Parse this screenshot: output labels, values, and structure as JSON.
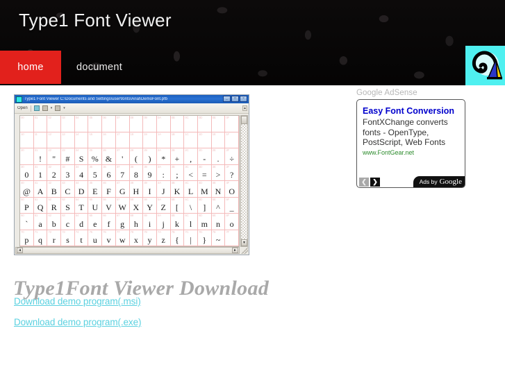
{
  "header": {
    "site_title": "Type1 Font Viewer",
    "logo_icon": "type1-font-logo-icon",
    "nav": [
      {
        "label": "home",
        "active": true
      },
      {
        "label": "document",
        "active": false
      }
    ]
  },
  "main": {
    "page_title": "Type1Font Viewer Download",
    "links": [
      {
        "label": "Download demo program(.msi)"
      },
      {
        "label": "Download demo program(.exe)"
      }
    ]
  },
  "screenshot": {
    "window_title": "Type1 Font Viewer C:\\Documents and Settings\\user\\fonts\\Arial\\DemoFont.pfb",
    "app_icon": "type1-font-app-icon",
    "toolbar": {
      "open_label": "Open",
      "icons": [
        "folder-open-icon",
        "zoom-icon",
        "print-icon"
      ]
    },
    "window_buttons": [
      "minimize",
      "maximize",
      "close"
    ],
    "charmap": {
      "hex_labels": [
        "00",
        "01",
        "02",
        "03",
        "04",
        "05",
        "06",
        "07",
        "08",
        "09",
        "0A",
        "0B",
        "0C",
        "0D",
        "0E",
        "0F",
        "10",
        "11",
        "12",
        "13",
        "14",
        "15",
        "16",
        "17",
        "18",
        "19",
        "1A",
        "1B",
        "1C",
        "1D",
        "1E",
        "1F",
        "20",
        "21",
        "22",
        "23",
        "24",
        "25",
        "26",
        "27",
        "28",
        "29",
        "2A",
        "2B",
        "2C",
        "2D",
        "2E",
        "2F",
        "30",
        "31",
        "32",
        "33",
        "34",
        "35",
        "36",
        "37",
        "38",
        "39",
        "3A",
        "3B",
        "3C",
        "3D",
        "3E",
        "3F",
        "40",
        "41",
        "42",
        "43",
        "44",
        "45",
        "46",
        "47",
        "48",
        "49",
        "4A",
        "4B",
        "4C",
        "4D",
        "4E",
        "4F",
        "50",
        "51",
        "52",
        "53",
        "54",
        "55",
        "56",
        "57",
        "58",
        "59",
        "5A",
        "5B",
        "5C",
        "5D",
        "5E",
        "5F",
        "60",
        "61",
        "62",
        "63",
        "64",
        "65",
        "66",
        "67",
        "68",
        "69",
        "6A",
        "6B",
        "6C",
        "6D",
        "6E",
        "6F",
        "70",
        "71",
        "72",
        "73",
        "74",
        "75",
        "76",
        "77",
        "78",
        "79",
        "7A",
        "7B",
        "7C",
        "7D",
        "7E",
        "7F"
      ],
      "glyphs": [
        "",
        "",
        "",
        "",
        "",
        "",
        "",
        "",
        "",
        "",
        "",
        "",
        "",
        "",
        "",
        "",
        "",
        "",
        "",
        "",
        "",
        "",
        "",
        "",
        "",
        "",
        "",
        "",
        "",
        "",
        "",
        "",
        "",
        "!",
        "\"",
        "#",
        "S",
        "%",
        "&",
        "'",
        "(",
        ")",
        "*",
        "+",
        ",",
        "-",
        ".",
        "÷",
        "0",
        "1",
        "2",
        "3",
        "4",
        "5",
        "6",
        "7",
        "8",
        "9",
        ":",
        ";",
        "<",
        "=",
        ">",
        "?",
        "@",
        "A",
        "B",
        "C",
        "D",
        "E",
        "F",
        "G",
        "H",
        "I",
        "J",
        "K",
        "L",
        "M",
        "N",
        "O",
        "P",
        "Q",
        "R",
        "S",
        "T",
        "U",
        "V",
        "W",
        "X",
        "Y",
        "Z",
        "[",
        "\\",
        "]",
        "^",
        "_",
        "`",
        "a",
        "b",
        "c",
        "d",
        "e",
        "f",
        "g",
        "h",
        "i",
        "j",
        "k",
        "l",
        "m",
        "n",
        "o",
        "p",
        "q",
        "r",
        "s",
        "t",
        "u",
        "v",
        "w",
        "x",
        "y",
        "z",
        "{",
        "|",
        "}",
        "~",
        ""
      ]
    },
    "scroll": {
      "down_arrow": "▼",
      "left_arrow": "◄",
      "right_arrow": "►"
    }
  },
  "adsense": {
    "label": "Google AdSense",
    "ad": {
      "headline": "Easy Font Conversion",
      "line1": "FontXChange converts",
      "line2": "fonts - OpenType,",
      "line3": "PostScript, Web Fonts",
      "url": "www.FontGear.net"
    },
    "prev_arrow": "❮",
    "next_arrow": "❯",
    "by_label": "Ads by",
    "by_brand": "Google"
  },
  "colors": {
    "accent_red": "#e2211c",
    "link_cyan": "#5bd1e0",
    "title_gray": "#a9a9a9",
    "header_black": "#0a0808",
    "logo_cyan": "#4ff0f0",
    "ad_blue": "#0000cc",
    "ad_green": "#2a8a2a"
  }
}
